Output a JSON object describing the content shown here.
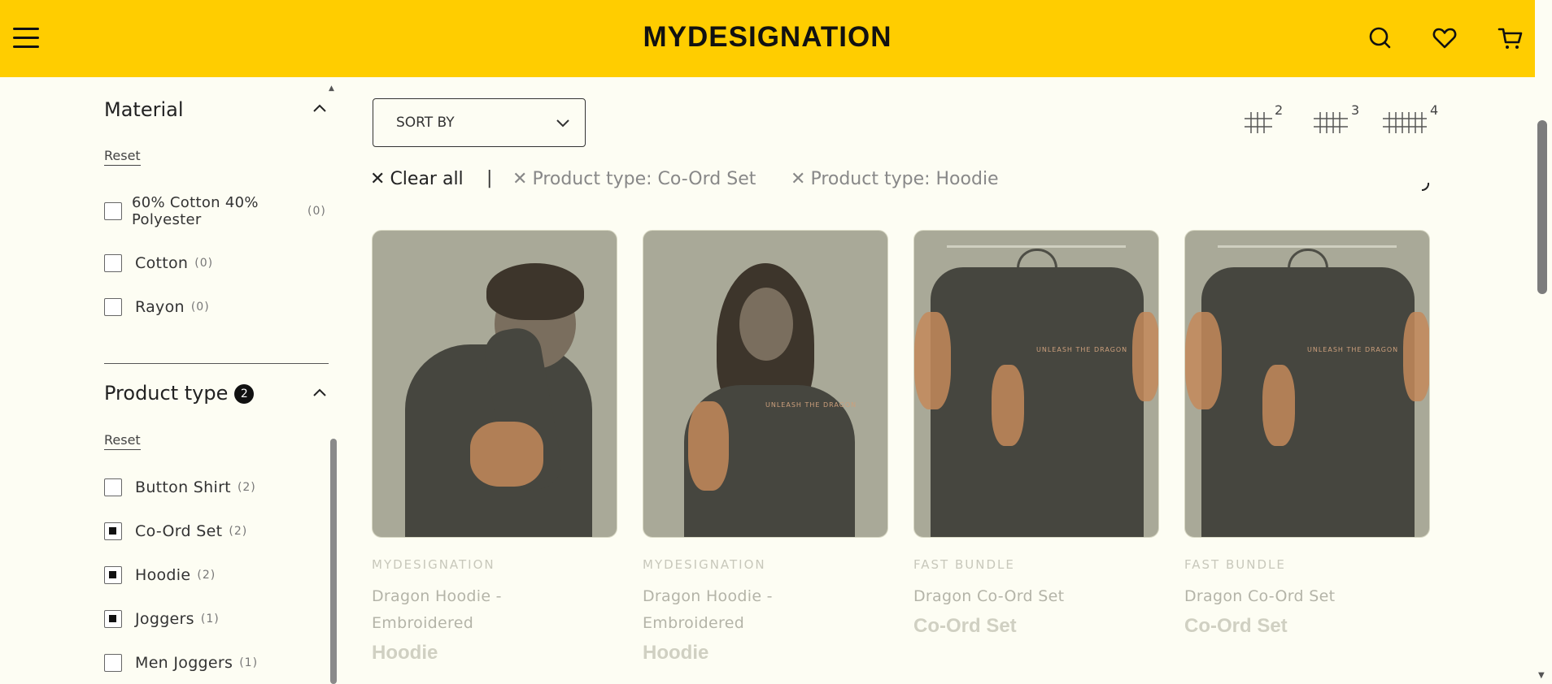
{
  "header": {
    "logo": "MYDESIGNATION",
    "icons": [
      "menu-icon",
      "search-icon",
      "heart-icon",
      "cart-icon"
    ]
  },
  "filters": {
    "material": {
      "title": "Material",
      "reset": "Reset",
      "options": [
        {
          "label": "60% Cotton 40% Polyester",
          "count": "(0)",
          "checked": false
        },
        {
          "label": "Cotton",
          "count": "(0)",
          "checked": false
        },
        {
          "label": "Rayon",
          "count": "(0)",
          "checked": false
        }
      ]
    },
    "product_type": {
      "title": "Product type",
      "badge": "2",
      "reset": "Reset",
      "options": [
        {
          "label": "Button Shirt",
          "count": "(2)",
          "checked": false
        },
        {
          "label": "Co-Ord Set",
          "count": "(2)",
          "checked": true
        },
        {
          "label": "Hoodie",
          "count": "(2)",
          "checked": true
        },
        {
          "label": "Joggers",
          "count": "(1)",
          "checked": true
        },
        {
          "label": "Men Joggers",
          "count": "(1)",
          "checked": false
        }
      ]
    }
  },
  "toolbar": {
    "sort_label": "SORT BY",
    "grid_options": [
      "2",
      "3",
      "4"
    ]
  },
  "active_filters": {
    "clear_all": "Clear all",
    "separator": "|",
    "chips": [
      "Product type: Co-Ord Set",
      "Product type: Hoodie"
    ]
  },
  "products": [
    {
      "vendor": "MYDESIGNATION",
      "title_line1": "Dragon Hoodie -",
      "title_line2": "Embroidered",
      "type": "Hoodie"
    },
    {
      "vendor": "MYDESIGNATION",
      "title_line1": "Dragon Hoodie -",
      "title_line2": "Embroidered",
      "type": "Hoodie"
    },
    {
      "vendor": "FAST BUNDLE",
      "title_line1": "Dragon Co-Ord Set",
      "title_line2": "",
      "type": "Co-Ord Set"
    },
    {
      "vendor": "FAST BUNDLE",
      "title_line1": "Dragon Co-Ord Set",
      "title_line2": "",
      "type": "Co-Ord Set"
    }
  ],
  "product_images": [
    {
      "print_text": ""
    },
    {
      "print_text": "UNLEASH THE DRAGON"
    },
    {
      "print_text": "UNLEASH THE DRAGON"
    },
    {
      "print_text": "UNLEASH THE DRAGON"
    }
  ],
  "colors": {
    "header_bg": "#ffcd00",
    "page_bg": "#fdfdf3"
  }
}
